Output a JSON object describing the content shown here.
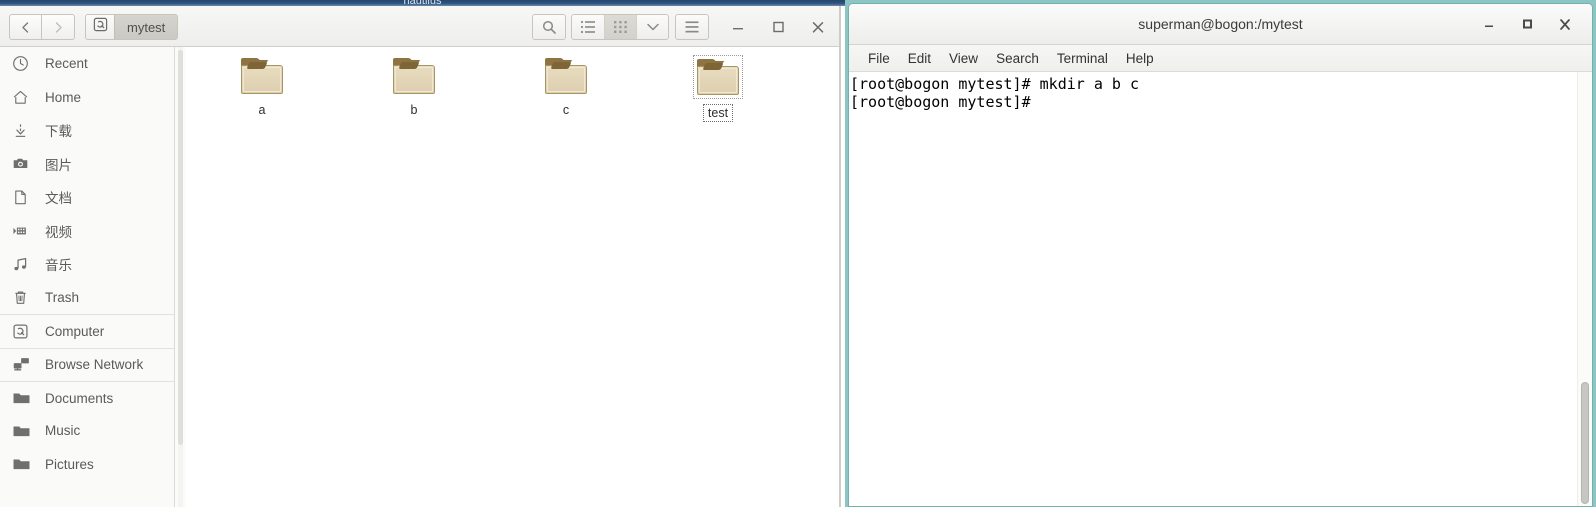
{
  "top_strip": {
    "partial_title": "nautilus"
  },
  "file_manager": {
    "toolbar": {
      "back_label": "Back",
      "forward_label": "Forward",
      "path_root_icon": "computer-icon",
      "path_current": "mytest",
      "search_label": "Search",
      "view_list_label": "List view",
      "view_grid_label": "Grid view",
      "view_dropdown_label": "View options",
      "menu_label": "Menu",
      "minimize_label": "Minimize",
      "maximize_label": "Maximize",
      "close_label": "Close"
    },
    "sidebar": {
      "items": [
        {
          "label": "Recent",
          "icon": "clock-icon",
          "separator_above": false
        },
        {
          "label": "Home",
          "icon": "home-icon",
          "separator_above": false
        },
        {
          "label": "下载",
          "icon": "download-icon",
          "separator_above": false
        },
        {
          "label": "图片",
          "icon": "camera-icon",
          "separator_above": false
        },
        {
          "label": "文档",
          "icon": "document-icon",
          "separator_above": false
        },
        {
          "label": "视频",
          "icon": "video-icon",
          "separator_above": false
        },
        {
          "label": "音乐",
          "icon": "music-icon",
          "separator_above": false
        },
        {
          "label": "Trash",
          "icon": "trash-icon",
          "separator_above": false
        },
        {
          "label": "Computer",
          "icon": "computer-icon",
          "separator_above": true
        },
        {
          "label": "Browse Network",
          "icon": "network-icon",
          "separator_above": true
        },
        {
          "label": "Documents",
          "icon": "folder-icon",
          "separator_above": true
        },
        {
          "label": "Music",
          "icon": "folder-icon",
          "separator_above": false
        },
        {
          "label": "Pictures",
          "icon": "folder-icon",
          "separator_above": false
        }
      ]
    },
    "files": [
      {
        "name": "a",
        "icon": "folder-icon",
        "selected": false
      },
      {
        "name": "b",
        "icon": "folder-icon",
        "selected": false
      },
      {
        "name": "c",
        "icon": "folder-icon",
        "selected": false
      },
      {
        "name": "test",
        "icon": "folder-icon",
        "selected": true
      }
    ]
  },
  "terminal": {
    "title": "superman@bogon:/mytest",
    "menu": [
      {
        "label": "File"
      },
      {
        "label": "Edit"
      },
      {
        "label": "View"
      },
      {
        "label": "Search"
      },
      {
        "label": "Terminal"
      },
      {
        "label": "Help"
      }
    ],
    "window_buttons": {
      "minimize_label": "Minimize",
      "maximize_label": "Maximize",
      "close_label": "Close"
    },
    "content": "[root@bogon mytest]# mkdir a b c\n[root@bogon mytest]# "
  },
  "colors": {
    "terminal_frame": "#8dc5c2",
    "folder_body": "#ddcfae",
    "folder_tab": "#8e7441",
    "toolbar_bg": "#eeeeec",
    "sidebar_bg": "#fafaf9",
    "file_area_bg": "#ffffff",
    "terminal_bg": "#ffffff",
    "terminal_text": "#000000"
  }
}
